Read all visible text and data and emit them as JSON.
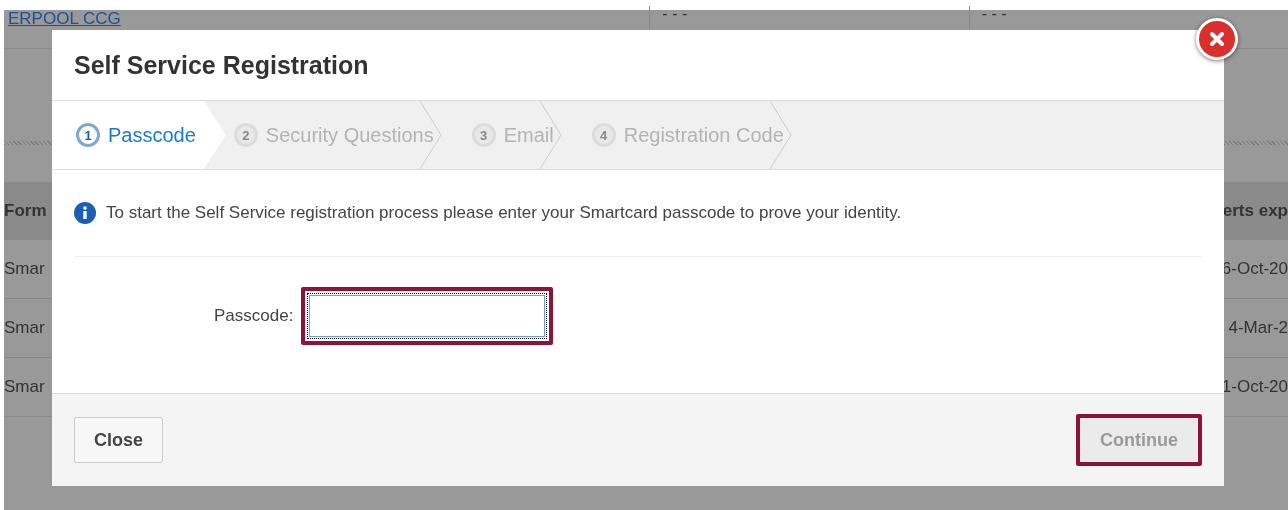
{
  "background_page": {
    "link": "ERPOOL CCG",
    "top_cells": [
      "- - -",
      "- - -"
    ],
    "left_column": {
      "header": "Form",
      "cells": [
        "Smar",
        "Smar",
        "Smar"
      ]
    },
    "right_column": {
      "header": "erts exp",
      "cells": [
        "6-Oct-20",
        "4-Mar-2",
        "1-Oct-20"
      ]
    }
  },
  "dialog": {
    "title": "Self Service Registration",
    "steps": [
      {
        "number": "1",
        "label": "Passcode",
        "selected": true
      },
      {
        "number": "2",
        "label": "Security Questions",
        "selected": false
      },
      {
        "number": "3",
        "label": "Email",
        "selected": false
      },
      {
        "number": "4",
        "label": "Registration Code",
        "selected": false
      }
    ],
    "info": "To start the Self Service registration process please enter your Smartcard passcode to prove your identity.",
    "field": {
      "label": "Passcode:",
      "focused": true,
      "highlighted": true
    },
    "buttons": [
      {
        "label": "Close",
        "kind": "secondary",
        "disabled": false,
        "highlighted": false
      },
      {
        "label": "Continue",
        "kind": "primary",
        "disabled": true,
        "highlighted": true
      }
    ]
  }
}
